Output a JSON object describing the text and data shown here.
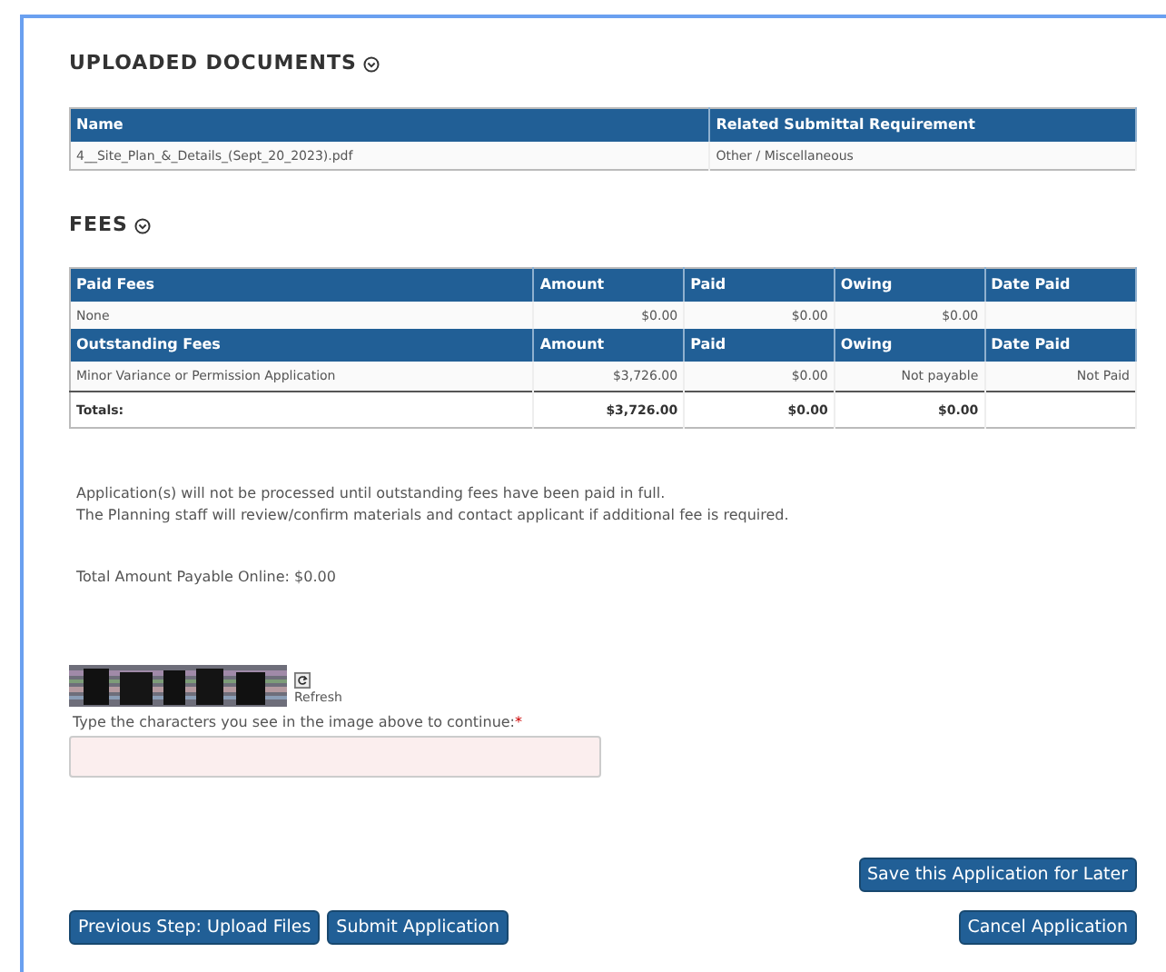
{
  "documents": {
    "title": "UPLOADED DOCUMENTS",
    "columns": [
      "Name",
      "Related Submittal Requirement"
    ],
    "rows": [
      [
        "4__Site_Plan_&_Details_(Sept_20_2023).pdf",
        "Other / Miscellaneous"
      ]
    ]
  },
  "fees": {
    "title": "FEES",
    "groups": [
      {
        "columns": [
          "Paid Fees",
          "Amount",
          "Paid",
          "Owing",
          "Date Paid"
        ],
        "rows": [
          [
            "None",
            "$0.00",
            "$0.00",
            "$0.00"
          ]
        ]
      },
      {
        "columns": [
          "Outstanding Fees",
          "Amount",
          "Paid",
          "Owing",
          "Date Paid"
        ],
        "rows": [
          [
            "Minor Variance or Permission Application",
            "$3,726.00",
            "$0.00",
            "Not payable",
            "Not Paid"
          ]
        ]
      }
    ],
    "totals": [
      "Totals:",
      "$3,726.00",
      "$0.00",
      "$0.00"
    ]
  },
  "notes": [
    "Application(s) will not be processed until outstanding fees have been paid in full.",
    "The Planning staff will review/confirm materials and contact applicant if additional fee is required."
  ],
  "total_payable": "Total Amount Payable Online: $0.00",
  "captcha": {
    "refresh": "Refresh",
    "label": "Type the characters you see in the image above to continue:",
    "required_mark": "*"
  },
  "buttons_top": [
    "Save this Application for Later"
  ],
  "buttons_left": [
    "Previous Step: Upload Files",
    "Submit Application"
  ],
  "buttons_right": [
    "Cancel Application"
  ]
}
